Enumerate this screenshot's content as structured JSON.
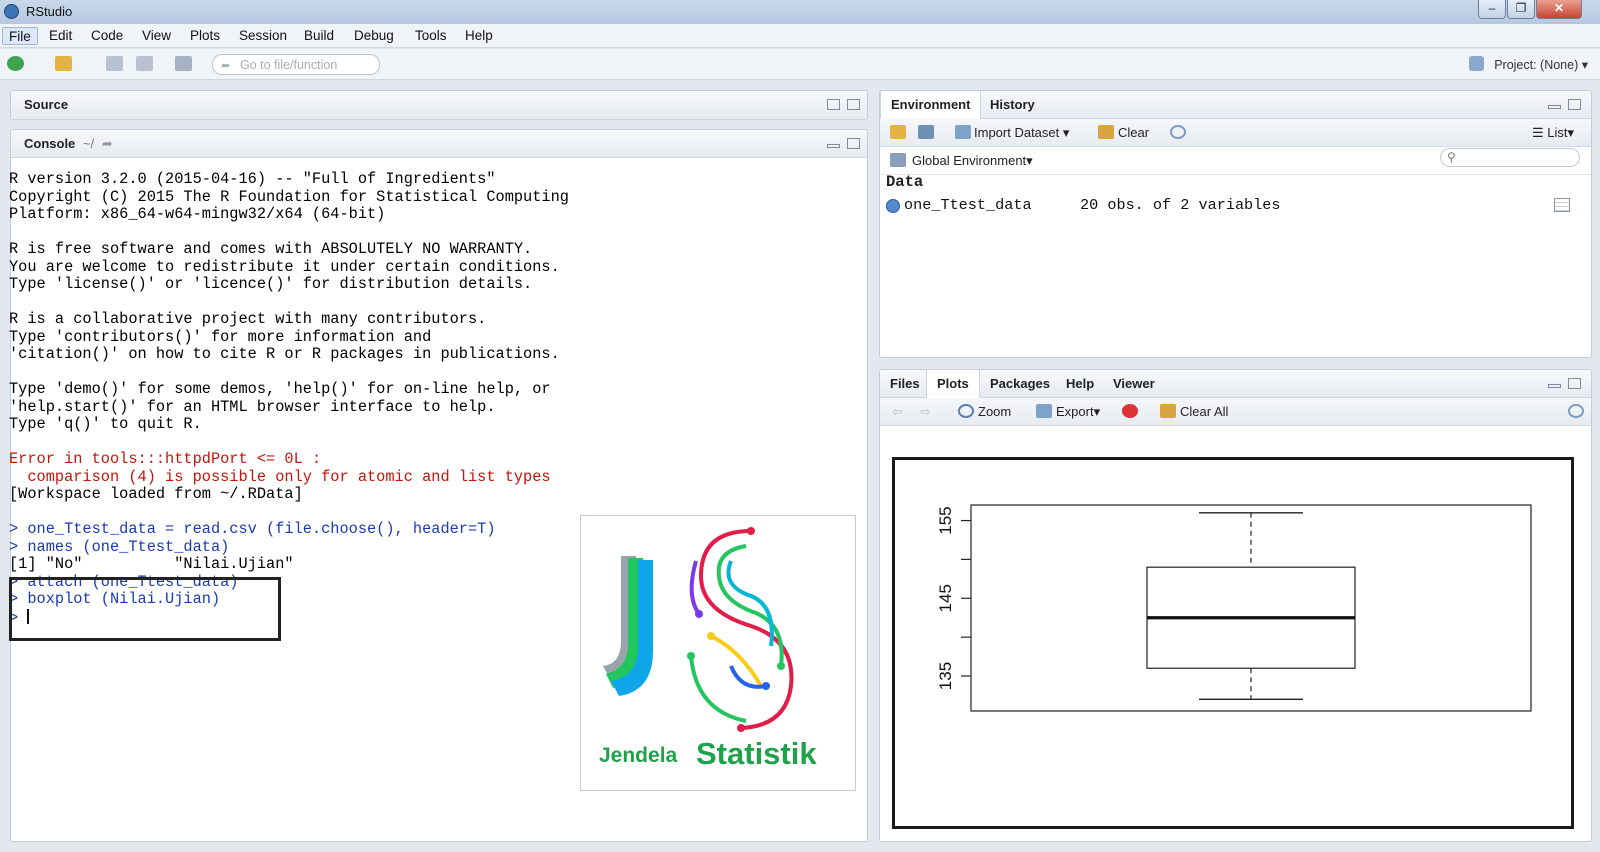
{
  "window": {
    "title": "RStudio",
    "controls": [
      "–",
      "❐",
      "✕"
    ]
  },
  "menu": [
    "File",
    "Edit",
    "Code",
    "View",
    "Plots",
    "Session",
    "Build",
    "Debug",
    "Tools",
    "Help"
  ],
  "toolbar": {
    "goto_placeholder": "Go to file/function",
    "project_label": "Project: (None)"
  },
  "source_pane": {
    "title": "Source"
  },
  "console": {
    "title": "Console",
    "path": "~/",
    "lines": [
      {
        "text": "R version 3.2.0 (2015-04-16) -- \"Full of Ingredients\"",
        "kind": "out"
      },
      {
        "text": "Copyright (C) 2015 The R Foundation for Statistical Computing",
        "kind": "out"
      },
      {
        "text": "Platform: x86_64-w64-mingw32/x64 (64-bit)",
        "kind": "out"
      },
      {
        "text": "",
        "kind": "out"
      },
      {
        "text": "R is free software and comes with ABSOLUTELY NO WARRANTY.",
        "kind": "out"
      },
      {
        "text": "You are welcome to redistribute it under certain conditions.",
        "kind": "out"
      },
      {
        "text": "Type 'license()' or 'licence()' for distribution details.",
        "kind": "out"
      },
      {
        "text": "",
        "kind": "out"
      },
      {
        "text": "R is a collaborative project with many contributors.",
        "kind": "out"
      },
      {
        "text": "Type 'contributors()' for more information and",
        "kind": "out"
      },
      {
        "text": "'citation()' on how to cite R or R packages in publications.",
        "kind": "out"
      },
      {
        "text": "",
        "kind": "out"
      },
      {
        "text": "Type 'demo()' for some demos, 'help()' for on-line help, or",
        "kind": "out"
      },
      {
        "text": "'help.start()' for an HTML browser interface to help.",
        "kind": "out"
      },
      {
        "text": "Type 'q()' to quit R.",
        "kind": "out"
      },
      {
        "text": "",
        "kind": "out"
      },
      {
        "text": "Error in tools:::httpdPort <= 0L :",
        "kind": "err"
      },
      {
        "text": "  comparison (4) is possible only for atomic and list types",
        "kind": "err"
      },
      {
        "text": "[Workspace loaded from ~/.RData]",
        "kind": "out"
      },
      {
        "text": "",
        "kind": "out"
      },
      {
        "text": "> one_Ttest_data = read.csv (file.choose(), header=T)",
        "kind": "cmd"
      },
      {
        "text": "> names (one_Ttest_data)",
        "kind": "cmd"
      },
      {
        "text": "[1] \"No\"          \"Nilai.Ujian\"",
        "kind": "out"
      },
      {
        "text": "> attach (one_Ttest_data)",
        "kind": "cmd"
      },
      {
        "text": "> boxplot (Nilai.Ujian)",
        "kind": "cmd"
      }
    ],
    "prompt": "> "
  },
  "logo": {
    "word1": "Jendela",
    "word2": "Statistik"
  },
  "environment_pane": {
    "tabs": [
      "Environment",
      "History"
    ],
    "import_label": "Import Dataset",
    "clear_label": "Clear",
    "view_label": "List",
    "scope_label": "Global Environment",
    "section_label": "Data",
    "rows": [
      {
        "name": "one_Ttest_data",
        "value": "20 obs. of 2 variables"
      }
    ]
  },
  "files_pane": {
    "tabs": [
      "Files",
      "Plots",
      "Packages",
      "Help",
      "Viewer"
    ],
    "zoom_label": "Zoom",
    "export_label": "Export",
    "clear_all_label": "Clear All"
  },
  "chart_data": {
    "type": "boxplot",
    "series": [
      {
        "min": 132,
        "q1": 136,
        "median": 142.5,
        "q3": 149,
        "max": 156
      }
    ],
    "ylim": [
      130.5,
      157
    ],
    "y_ticks": [
      135,
      140,
      145,
      150,
      155
    ],
    "y_tick_labels": [
      "135",
      "145",
      "155"
    ],
    "title": "",
    "xlabel": "",
    "ylabel": ""
  }
}
